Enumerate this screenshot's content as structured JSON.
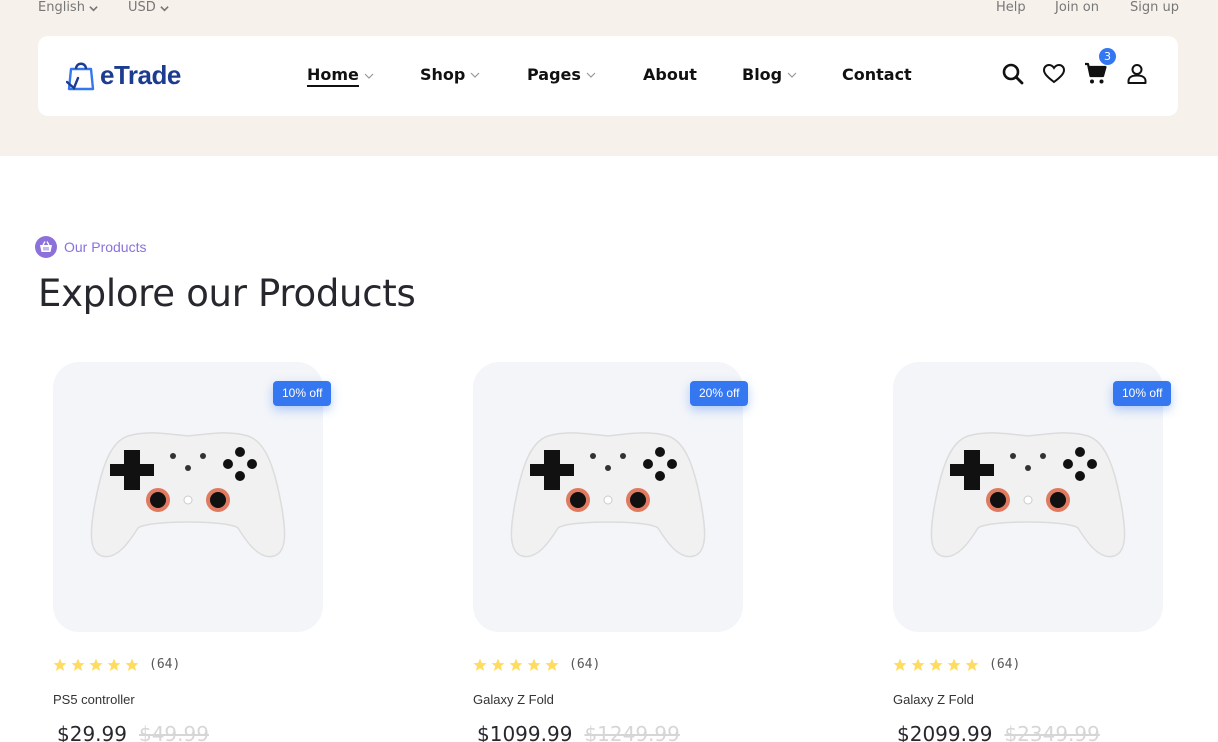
{
  "topbar": {
    "language": "English",
    "currency": "USD",
    "help": "Help",
    "join": "Join on",
    "signup": "Sign up"
  },
  "brand": {
    "name": "eTrade",
    "color": "#1c3d8f"
  },
  "nav": {
    "home": "Home",
    "shop": "Shop",
    "pages": "Pages",
    "about": "About",
    "blog": "Blog",
    "contact": "Contact"
  },
  "header_icons": [
    "search-icon",
    "heart-icon",
    "cart-icon",
    "user-icon"
  ],
  "cart": {
    "count": "3"
  },
  "section": {
    "tag": "Our Products",
    "title": "Explore our Products"
  },
  "products": [
    {
      "discount": "10% off",
      "rating": 5,
      "reviews": "(64)",
      "name": "PS5 controller",
      "price": "$29.99",
      "old_price": "$49.99"
    },
    {
      "discount": "20% off",
      "rating": 5,
      "reviews": "(64)",
      "name": "Galaxy Z Fold",
      "price": "$1099.99",
      "old_price": "$1249.99"
    },
    {
      "discount": "10% off",
      "rating": 5,
      "reviews": "(64)",
      "name": "Galaxy Z Fold",
      "price": "$2099.99",
      "old_price": "$2349.99"
    }
  ],
  "colors": {
    "accent": "#3577f0",
    "header_bg": "#f7f1ec",
    "tag": "#8c71db",
    "star": "#ffdc60"
  }
}
